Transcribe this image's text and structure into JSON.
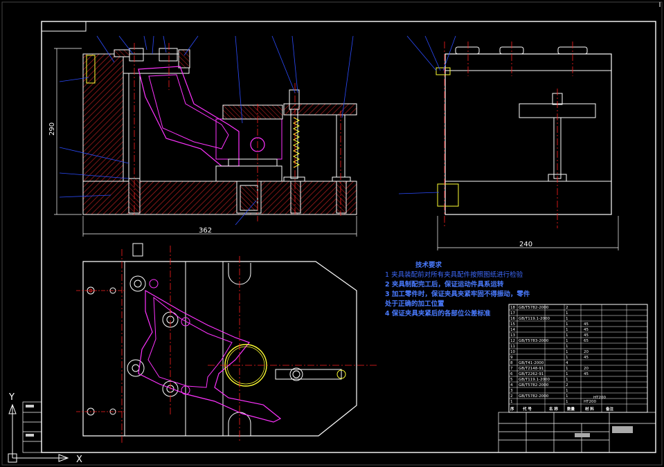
{
  "drawing": {
    "dimensions": {
      "front_width": "362",
      "front_height": "290",
      "side_width": "240"
    },
    "tech_requirements": {
      "title": "技术要求",
      "items": [
        "1  夹具装配前对所有夹具配件按照图纸进行检验",
        "2  夹具制配完工后，保证运动件具系运转",
        "3  加工零件时，保证夹具夹紧牢固不得振动，零件",
        "    处于正确的加工位置",
        "4  保证夹具夹紧后的各部位公差标准"
      ]
    },
    "bom": {
      "header": [
        "序",
        "代 号",
        "名 称",
        "数量",
        "材 料",
        "备注"
      ],
      "material_note": "HT200",
      "rows": [
        {
          "no": "18",
          "code": "GB/T5782-2000",
          "name": "",
          "qty": "2",
          "mat": "",
          "note": ""
        },
        {
          "no": "17",
          "code": "",
          "name": "",
          "qty": "1",
          "mat": "",
          "note": ""
        },
        {
          "no": "16",
          "code": "GB/T119.1-2000",
          "name": "",
          "qty": "1",
          "mat": "",
          "note": ""
        },
        {
          "no": "15",
          "code": "",
          "name": "",
          "qty": "1",
          "mat": "45",
          "note": ""
        },
        {
          "no": "14",
          "code": "",
          "name": "",
          "qty": "1",
          "mat": "45",
          "note": ""
        },
        {
          "no": "13",
          "code": "",
          "name": "",
          "qty": "1",
          "mat": "45",
          "note": ""
        },
        {
          "no": "12",
          "code": "GB/T5783-2000",
          "name": "",
          "qty": "1",
          "mat": "65",
          "note": ""
        },
        {
          "no": "11",
          "code": "",
          "name": "",
          "qty": "1",
          "mat": "",
          "note": ""
        },
        {
          "no": "10",
          "code": "",
          "name": "",
          "qty": "1",
          "mat": "20",
          "note": ""
        },
        {
          "no": "9",
          "code": "",
          "name": "",
          "qty": "1",
          "mat": "45",
          "note": ""
        },
        {
          "no": "8",
          "code": "GB/T41-2000",
          "name": "",
          "qty": "4",
          "mat": "",
          "note": ""
        },
        {
          "no": "7",
          "code": "GB/T2148-91",
          "name": "",
          "qty": "1",
          "mat": "20",
          "note": ""
        },
        {
          "no": "6",
          "code": "GB/T2262-91",
          "name": "",
          "qty": "1",
          "mat": "45",
          "note": ""
        },
        {
          "no": "5",
          "code": "GB/T119.1-2000",
          "name": "",
          "qty": "1",
          "mat": "",
          "note": ""
        },
        {
          "no": "4",
          "code": "GB/T5782-2000",
          "name": "",
          "qty": "2",
          "mat": "",
          "note": ""
        },
        {
          "no": "3",
          "code": "",
          "name": "",
          "qty": "1",
          "mat": "",
          "note": ""
        },
        {
          "no": "2",
          "code": "GB/T5782-2000",
          "name": "",
          "qty": "1",
          "mat": "",
          "note": ""
        },
        {
          "no": "1",
          "code": "",
          "name": "",
          "qty": "1",
          "mat": "HT200",
          "note": ""
        }
      ]
    },
    "ucs": {
      "x_label": "X",
      "y_label": "Y"
    }
  },
  "colors": {
    "background": "#000000",
    "outline": "#ffffff",
    "hatch": "#b52020",
    "center": "#ff2020",
    "leader": "#2c4cff",
    "part": "#ff33ff",
    "circle": "#ffff33",
    "note": "#3f6bff"
  }
}
